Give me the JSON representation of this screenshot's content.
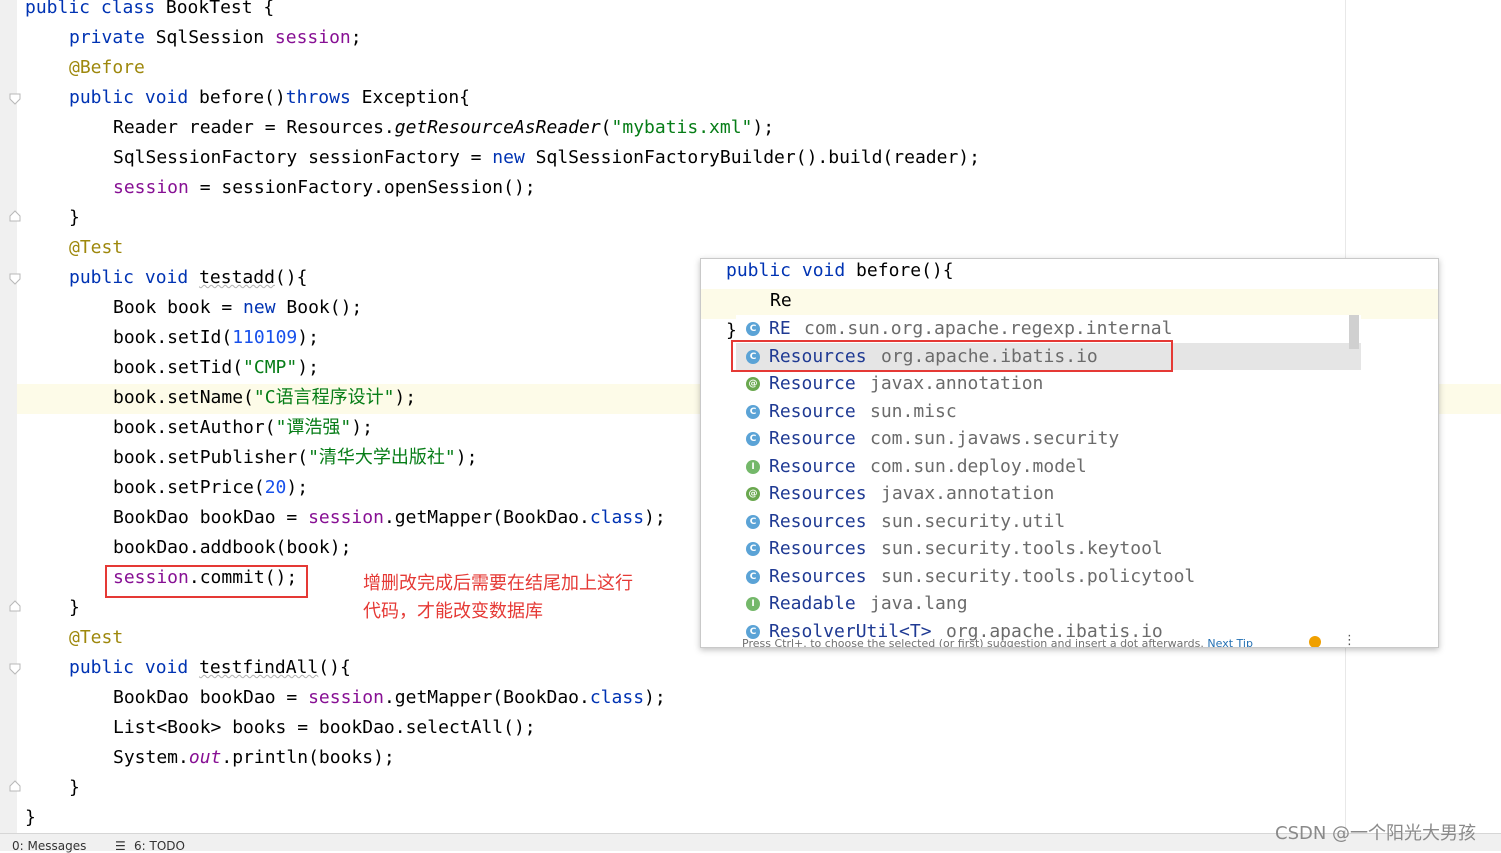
{
  "editor": {
    "l1": {
      "kw": "public class",
      "rest": " BookTest {"
    },
    "l2": {
      "kw": "private",
      "type": " SqlSession ",
      "fld": "session",
      "end": ";"
    },
    "l3": {
      "ann": "@Before"
    },
    "l4": {
      "kw1": "public void",
      "name": " before()",
      "kw2": "throws",
      "rest": " Exception{"
    },
    "l5": {
      "a": "Reader reader = Resources.",
      "m": "getResourceAsReader",
      "b": "(",
      "s": "\"mybatis.xml\"",
      "c": ");"
    },
    "l6": {
      "a": "SqlSessionFactory sessionFactory = ",
      "kw": "new",
      "b": " SqlSessionFactoryBuilder().build(reader);"
    },
    "l7": {
      "fld": "session",
      "b": " = sessionFactory.openSession();"
    },
    "l8": {
      "t": "}"
    },
    "l9": {
      "ann": "@Test"
    },
    "l10": {
      "kw": "public void",
      "name": "testadd",
      "rest": "(){"
    },
    "l11": {
      "a": "Book book = ",
      "kw": "new",
      "b": " Book();"
    },
    "l12": {
      "a": "book.setId(",
      "num": "110109",
      "b": ");"
    },
    "l13": {
      "a": "book.setTid(",
      "s": "\"CMP\"",
      "b": ");"
    },
    "l14": {
      "a": "book.setName(",
      "s": "\"C语言程序设计\"",
      "b": ");"
    },
    "l15": {
      "a": "book.setAuthor(",
      "s": "\"谭浩强\"",
      "b": ");"
    },
    "l16": {
      "a": "book.setPublisher(",
      "s": "\"清华大学出版社\"",
      "b": ");"
    },
    "l17": {
      "a": "book.setPrice(",
      "num": "20",
      "b": ");"
    },
    "l18": {
      "a": "BookDao bookDao = ",
      "fld": "session",
      "b": ".getMapper(BookDao.",
      "kw": "class",
      "c": ");"
    },
    "l19": {
      "t": "bookDao.addbook(book);"
    },
    "l20": {
      "fld": "session",
      "b": ".commit();"
    },
    "l21": {
      "t": "}"
    },
    "l22": {
      "ann": "@Test"
    },
    "l23": {
      "kw": "public void",
      "name": "testfindAll",
      "rest": "(){"
    },
    "l24": {
      "a": "BookDao bookDao = ",
      "fld": "session",
      "b": ".getMapper(BookDao.",
      "kw": "class",
      "c": ");"
    },
    "l25": {
      "t": "List<Book> books = bookDao.selectAll();"
    },
    "l26": {
      "a": "System.",
      "fld": "out",
      "b": ".println(books);"
    },
    "l27": {
      "t": "}"
    },
    "l28": {
      "t": "}"
    }
  },
  "annotation_note": {
    "line1": "增删改完成后需要在结尾加上这行",
    "line2": "代码，才能改变数据库"
  },
  "popup": {
    "code_line1": {
      "kw": "public void",
      "rest": " before(){"
    },
    "code_line2": "Re",
    "code_line3": "}",
    "items": [
      {
        "icon": "C",
        "kind": "class",
        "name": "RE",
        "pkg": "com.sun.org.apache.regexp.internal",
        "selected": false
      },
      {
        "icon": "C",
        "kind": "class",
        "name": "Resources",
        "pkg": "org.apache.ibatis.io",
        "selected": true
      },
      {
        "icon": "@",
        "kind": "anno",
        "name": "Resource",
        "pkg": "javax.annotation",
        "selected": false
      },
      {
        "icon": "C",
        "kind": "class",
        "name": "Resource",
        "pkg": "sun.misc",
        "selected": false
      },
      {
        "icon": "C",
        "kind": "class",
        "name": "Resource",
        "pkg": "com.sun.javaws.security",
        "selected": false
      },
      {
        "icon": "I",
        "kind": "iface",
        "name": "Resource",
        "pkg": "com.sun.deploy.model",
        "selected": false
      },
      {
        "icon": "@",
        "kind": "anno",
        "name": "Resources",
        "pkg": "javax.annotation",
        "selected": false
      },
      {
        "icon": "C",
        "kind": "class",
        "name": "Resources",
        "pkg": "sun.security.util",
        "selected": false
      },
      {
        "icon": "C",
        "kind": "class",
        "name": "Resources",
        "pkg": "sun.security.tools.keytool",
        "selected": false
      },
      {
        "icon": "C",
        "kind": "class",
        "name": "Resources",
        "pkg": "sun.security.tools.policytool",
        "selected": false
      },
      {
        "icon": "I",
        "kind": "iface",
        "name": "Readable",
        "pkg": "java.lang",
        "selected": false
      },
      {
        "icon": "C",
        "kind": "class",
        "name": "ResolverUtil<T>",
        "pkg": "org.apache.ibatis.io",
        "selected": false
      }
    ],
    "tip_text": "Press Ctrl+. to choose the selected (or first) suggestion and insert a dot afterwards.",
    "tip_link": "Next Tip"
  },
  "statusbar": {
    "messages": "0: Messages",
    "todo": "6: TODO"
  },
  "watermark": "CSDN @一个阳光大男孩",
  "colors": {
    "keyword": "#0033b3",
    "annotation": "#9e880d",
    "string": "#067d17",
    "number": "#1750eb",
    "field": "#871094",
    "highlight_box": "#e53935"
  }
}
